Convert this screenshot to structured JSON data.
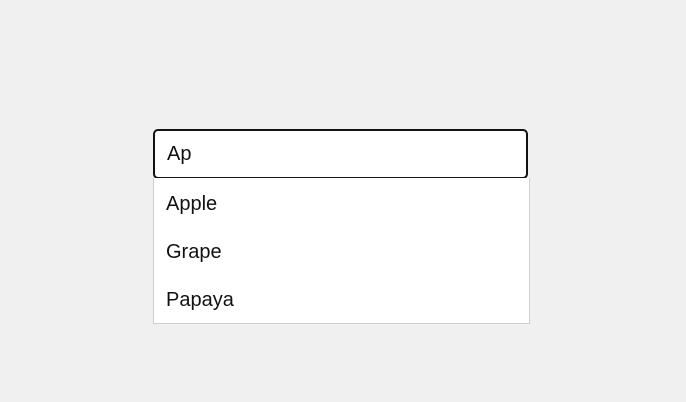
{
  "search": {
    "value": "Ap",
    "placeholder": ""
  },
  "suggestions": [
    {
      "label": "Apple"
    },
    {
      "label": "Grape"
    },
    {
      "label": "Papaya"
    }
  ]
}
